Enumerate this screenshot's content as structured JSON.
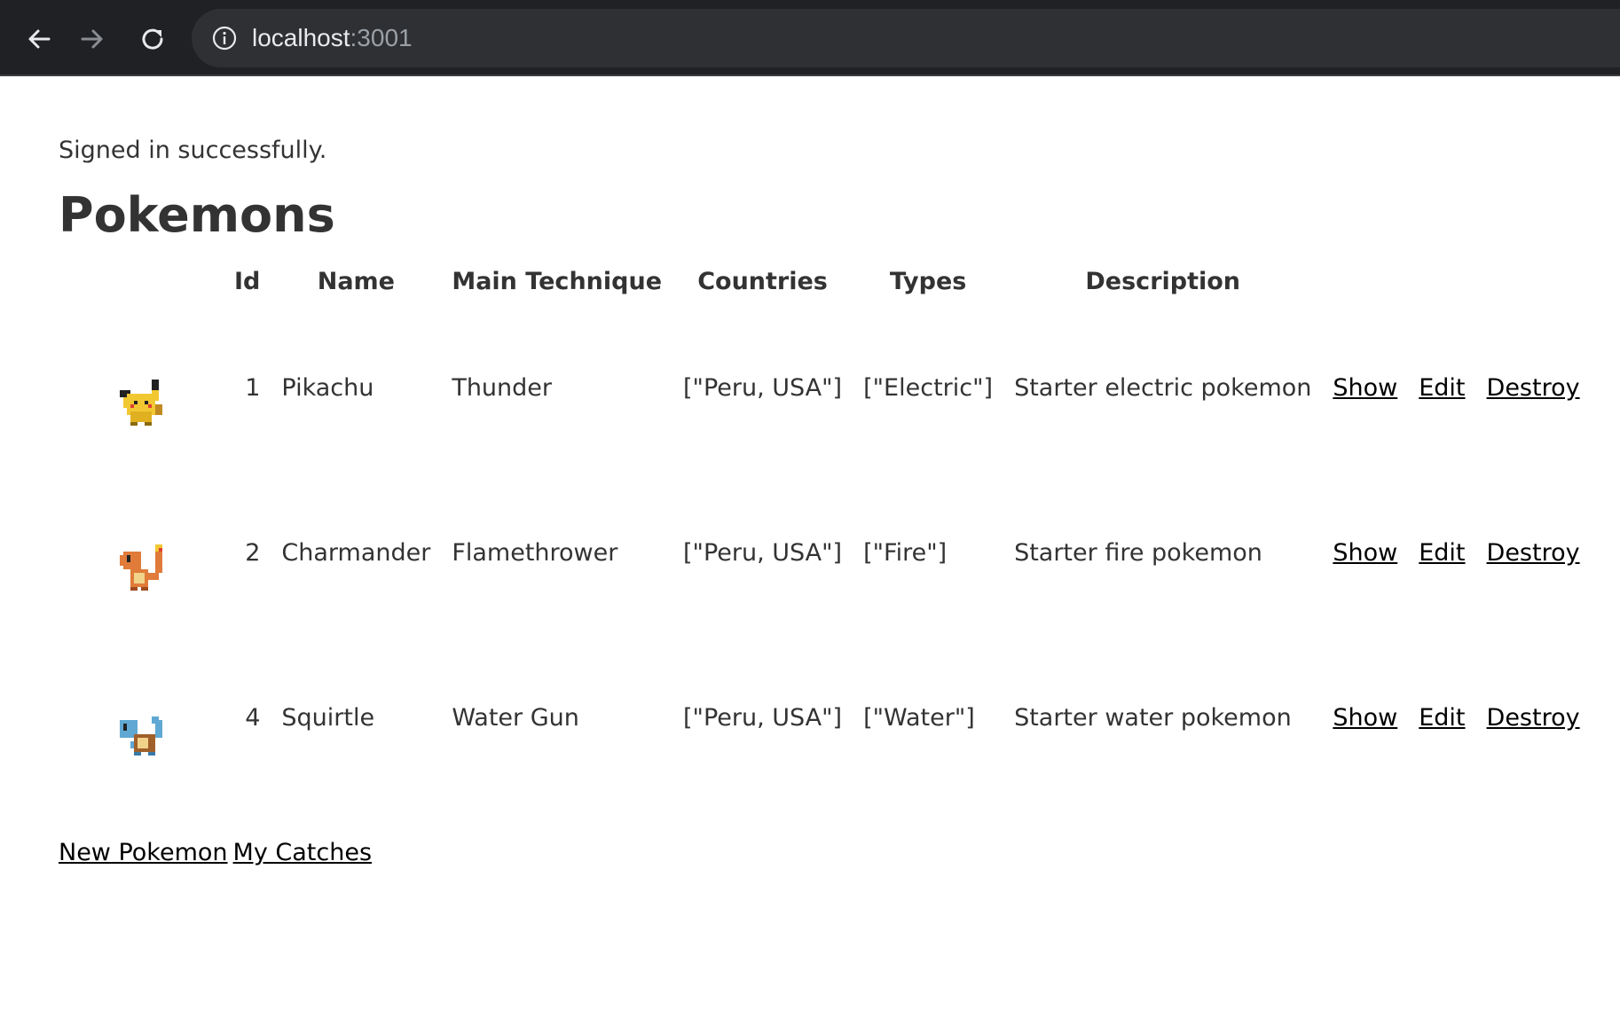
{
  "browser": {
    "url_host": "localhost",
    "url_port": ":3001",
    "back_icon": "arrow-left-icon",
    "forward_icon": "arrow-right-icon",
    "reload_icon": "reload-icon",
    "info_icon": "info-icon"
  },
  "page": {
    "notice": "Signed in successfully.",
    "title": "Pokemons"
  },
  "table": {
    "headers": [
      "",
      "Id",
      "Name",
      "Main Technique",
      "Countries",
      "Types",
      "Description"
    ],
    "rows": [
      {
        "sprite": "pikachu-sprite",
        "id": "1",
        "name": "Pikachu",
        "technique": "Thunder",
        "countries": "[\"Peru, USA\"]",
        "types": "[\"Electric\"]",
        "description": "Starter electric pokemon",
        "show": "Show",
        "edit": "Edit",
        "destroy": "Destroy"
      },
      {
        "sprite": "charmander-sprite",
        "id": "2",
        "name": "Charmander",
        "technique": "Flamethrower",
        "countries": "[\"Peru, USA\"]",
        "types": "[\"Fire\"]",
        "description": "Starter fire pokemon",
        "show": "Show",
        "edit": "Edit",
        "destroy": "Destroy"
      },
      {
        "sprite": "squirtle-sprite",
        "id": "4",
        "name": "Squirtle",
        "technique": "Water Gun",
        "countries": "[\"Peru, USA\"]",
        "types": "[\"Water\"]",
        "description": "Starter water pokemon",
        "show": "Show",
        "edit": "Edit",
        "destroy": "Destroy"
      }
    ]
  },
  "footer": {
    "new_pokemon": "New Pokemon",
    "my_catches": "My Catches"
  },
  "colors": {
    "toolbar": "#202124",
    "address_bar": "#2f3033",
    "text": "#333333",
    "link": "#000000",
    "pikachu": "#f2c832",
    "charmander": "#e07b39",
    "squirtle": "#5fa8d3"
  }
}
